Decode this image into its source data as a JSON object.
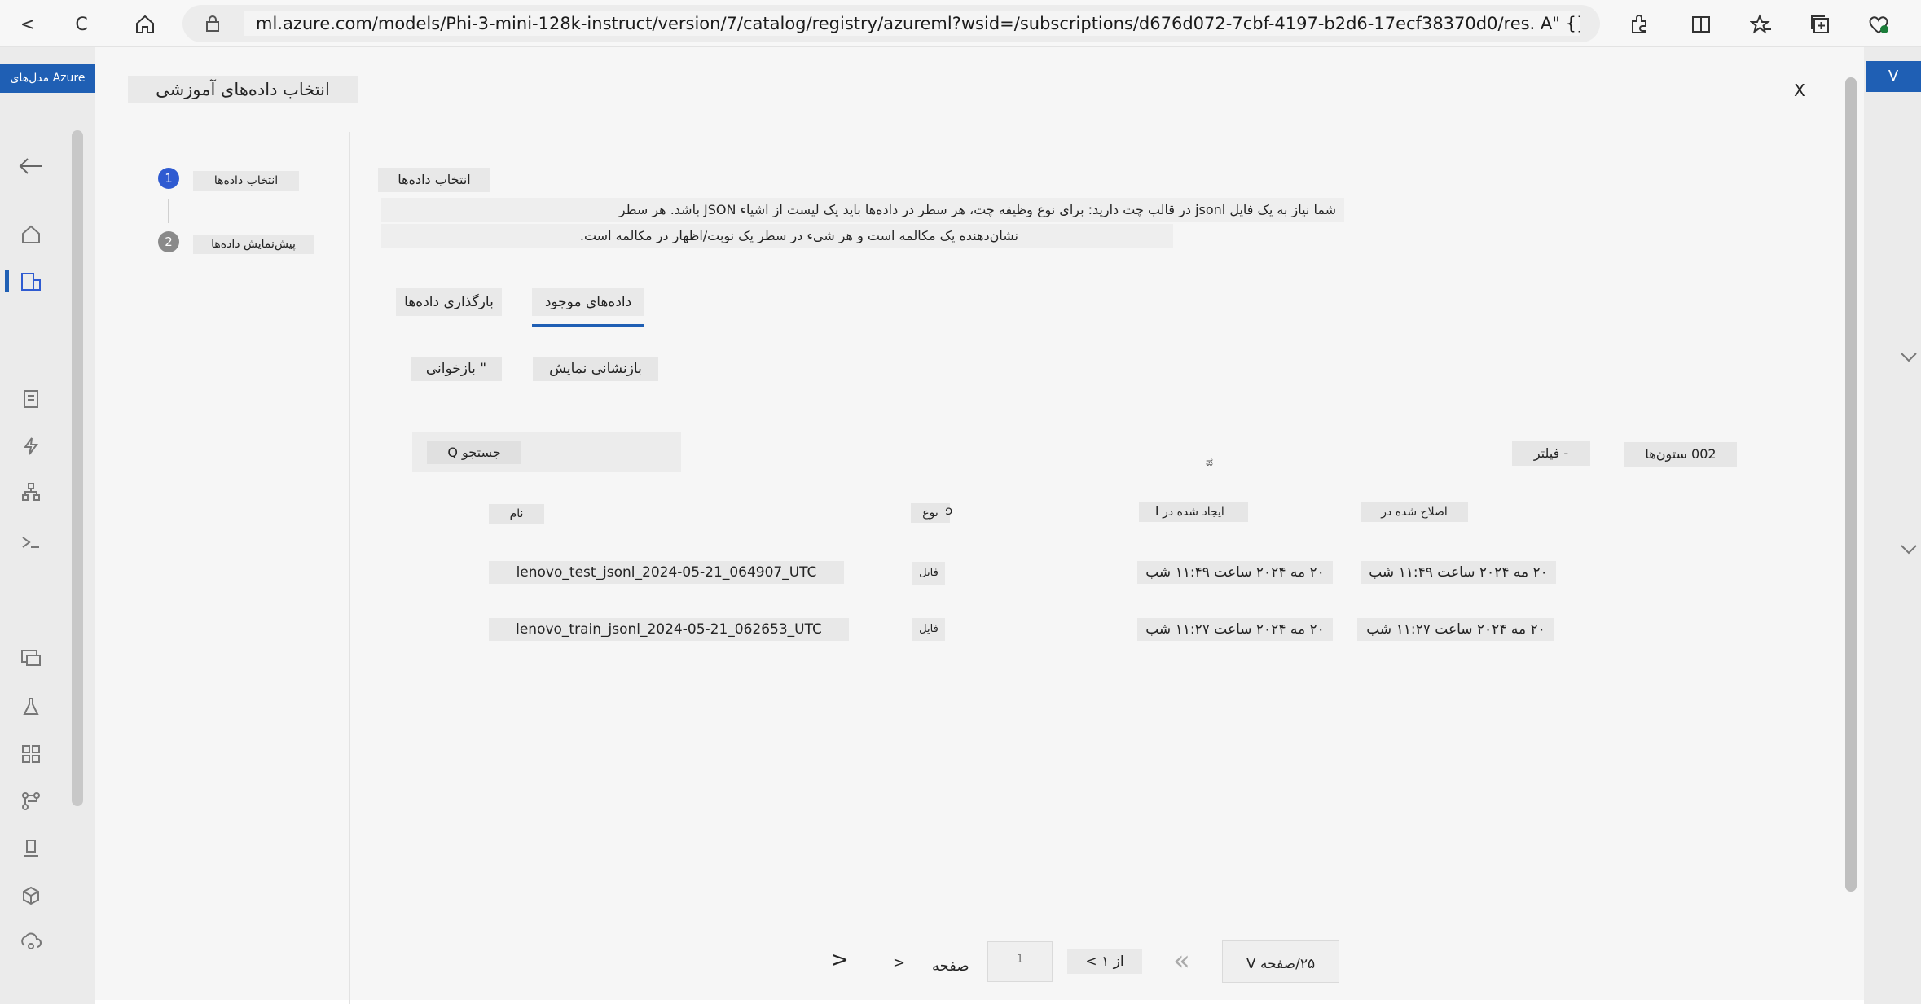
{
  "browser": {
    "back_label": "<",
    "reload_label": "C",
    "url": "ml.azure.com/models/Phi-3-mini-128k-instruct/version/7/catalog/registry/azureml?wsid=/subscriptions/d676d072-7cbf-4197-b2d6-17ecf38370d0/res. A\" {}"
  },
  "portal": {
    "left_tag": "مدل‌های Azure",
    "right_tag": "V"
  },
  "dialog": {
    "title": "انتخاب داده‌های آموزشی",
    "close_label": "X"
  },
  "steps": [
    {
      "number": "1",
      "label": "انتخاب داده‌ها",
      "color": "#2f5bd1"
    },
    {
      "number": "2",
      "label": "پیش‌نمایش داده‌ها",
      "color": "#8a8a8a"
    }
  ],
  "section": {
    "title": "انتخاب داده‌ها",
    "desc_line1": "شما نیاز به یک فایل jsonl در قالب چت دارید: برای نوع وظیفه چت، هر سطر در داده‌ها باید یک لیست از اشیاء JSON باشد. هر سطر",
    "desc_line2": "نشان‌دهنده یک مکالمه است و هر شیء در سطر یک نوبت/اظهار در مکالمه است."
  },
  "tabs": {
    "existing": "داده‌های موجود",
    "upload": "بارگذاری داده‌ها",
    "accent": "#1f5fb4"
  },
  "actions": {
    "refresh": "\" بازخوانی",
    "reset_view": "بازنشانی نمایش"
  },
  "toolbar": {
    "search": "جستجو Q",
    "filter": "- فیلتر",
    "columns": "002 ستون‌ها",
    "mid_glyph": "ಪ"
  },
  "table": {
    "headers": {
      "name": "نام",
      "type": "نوع",
      "type_glyph": "ɘ",
      "created": "ایجاد شده در",
      "created_glyph": "I",
      "modified": "اصلاح شده در"
    },
    "rows": [
      {
        "name": "lenovo_test_jsonl_2024-05-21_064907_UTC",
        "type": "فایل",
        "created": "۲۰ مه ۲۰۲۴ ساعت ۱۱:۴۹ شب",
        "modified": "۲۰ مه ۲۰۲۴ ساعت ۱۱:۴۹ شب"
      },
      {
        "name": "lenovo_train_jsonl_2024-05-21_062653_UTC",
        "type": "فایل",
        "created": "۲۰ مه ۲۰۲۴ ساعت ۱۱:۲۷ شب",
        "modified": "۲۰ مه ۲۰۲۴ ساعت ۱۱:۲۷ شب"
      }
    ]
  },
  "pagination": {
    "first": "<",
    "prev": "<",
    "page_label": "صفحه",
    "page_value": "1",
    "of_label": "از ۱ >",
    "last": "»",
    "per_page": "۲۵/صفحه V"
  }
}
